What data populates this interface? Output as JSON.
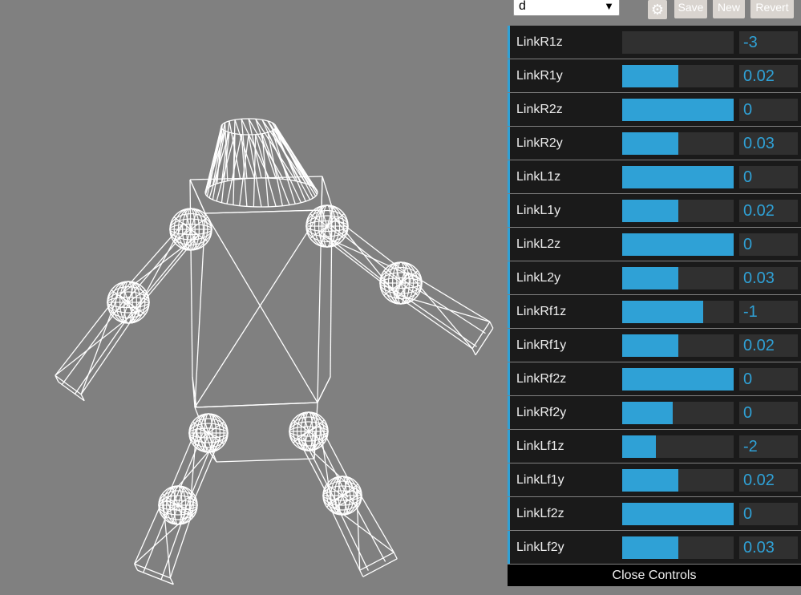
{
  "preset": {
    "selected": "d",
    "save_label": "Save",
    "new_label": "New",
    "revert_label": "Revert"
  },
  "controllers": [
    {
      "name": "LinkR1z",
      "value": "-3",
      "fill": 0.0
    },
    {
      "name": "LinkR1y",
      "value": "0.02",
      "fill": 0.5
    },
    {
      "name": "LinkR2z",
      "value": "0",
      "fill": 1.0
    },
    {
      "name": "LinkR2y",
      "value": "0.03",
      "fill": 0.5
    },
    {
      "name": "LinkL1z",
      "value": "0",
      "fill": 1.0
    },
    {
      "name": "LinkL1y",
      "value": "0.02",
      "fill": 0.5
    },
    {
      "name": "LinkL2z",
      "value": "0",
      "fill": 1.0
    },
    {
      "name": "LinkL2y",
      "value": "0.03",
      "fill": 0.5
    },
    {
      "name": "LinkRf1z",
      "value": "-1",
      "fill": 0.73
    },
    {
      "name": "LinkRf1y",
      "value": "0.02",
      "fill": 0.5
    },
    {
      "name": "LinkRf2z",
      "value": "0",
      "fill": 1.0
    },
    {
      "name": "LinkRf2y",
      "value": "0",
      "fill": 0.45
    },
    {
      "name": "LinkLf1z",
      "value": "-2",
      "fill": 0.3
    },
    {
      "name": "LinkLf1y",
      "value": "0.02",
      "fill": 0.5
    },
    {
      "name": "LinkLf2z",
      "value": "0",
      "fill": 1.0
    },
    {
      "name": "LinkLf2y",
      "value": "0.03",
      "fill": 0.5
    }
  ],
  "close_label": "Close Controls",
  "colors": {
    "accent": "#2fa1d6",
    "row_bg": "#1a1a1a",
    "viewport_bg": "#808080",
    "wire": "#ffffff"
  },
  "icons": {
    "gear": "gear-icon",
    "dropdown": "dropdown-arrow-icon"
  }
}
